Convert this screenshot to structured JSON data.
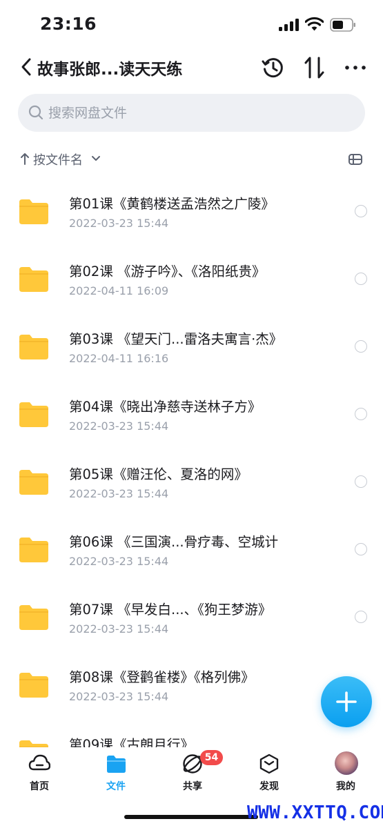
{
  "status_bar": {
    "time": "23:16"
  },
  "header": {
    "title": "故事张郎...读天天练"
  },
  "search": {
    "placeholder": "搜索网盘文件",
    "value": ""
  },
  "sort": {
    "label": "按文件名"
  },
  "files": [
    {
      "name": "第01课《黄鹤楼送孟浩然之广陵》",
      "date": "2022-03-23 15:44"
    },
    {
      "name": "第02课 《游子吟》、《洛阳纸贵》",
      "date": "2022-04-11 16:09"
    },
    {
      "name": "第03课 《望天门...雷洛夫寓言·杰》",
      "date": "2022-04-11 16:16"
    },
    {
      "name": "第04课《晓出净慈寺送林子方》",
      "date": "2022-03-23 15:44"
    },
    {
      "name": "第05课《赠汪伦、夏洛的网》",
      "date": "2022-03-23 15:44"
    },
    {
      "name": "第06课 《三国演...骨疗毒、空城计",
      "date": "2022-03-23 15:44"
    },
    {
      "name": "第07课 《早发白...、《狗王梦游》",
      "date": "2022-03-23 15:44"
    },
    {
      "name": "第08课《登鹳雀楼》《格列佛》",
      "date": "2022-03-23 15:44"
    },
    {
      "name": "第09课《古朗月行》",
      "date": ""
    }
  ],
  "nav": {
    "items": [
      {
        "label": "首页",
        "icon": "home-icon"
      },
      {
        "label": "文件",
        "icon": "folder-icon"
      },
      {
        "label": "共享",
        "icon": "share-icon"
      },
      {
        "label": "发现",
        "icon": "discover-icon"
      },
      {
        "label": "我的",
        "icon": "avatar"
      }
    ],
    "active_index": 1,
    "share_badge": "54"
  },
  "watermark": "WWW.XXTTQ.COM",
  "colors": {
    "accent": "#1aa3f2",
    "folder": "#ffc83a",
    "badge": "#f24b4b",
    "search_bg": "#eef0f4",
    "secondary_text": "#9aa0ab"
  }
}
